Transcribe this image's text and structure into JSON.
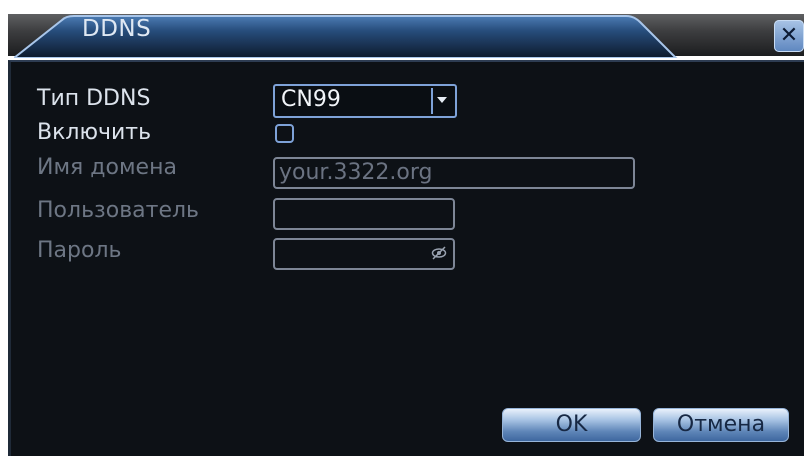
{
  "window": {
    "title": "DDNS",
    "close_label": "✕"
  },
  "form": {
    "ddns_type_label": "Тип DDNS",
    "ddns_type_value": "CN99",
    "enable_label": "Включить",
    "enable_checked": false,
    "domain_label": "Имя домена",
    "domain_value": "your.3322.org",
    "user_label": "Пользователь",
    "user_value": "",
    "password_label": "Пароль",
    "password_value": ""
  },
  "buttons": {
    "ok_label": "OK",
    "cancel_label": "Отмена"
  },
  "colors": {
    "panel_bg": "#0d1116",
    "label_enabled": "#dce3ec",
    "label_disabled": "#6d7684",
    "accent_border": "#7ea2d8"
  }
}
